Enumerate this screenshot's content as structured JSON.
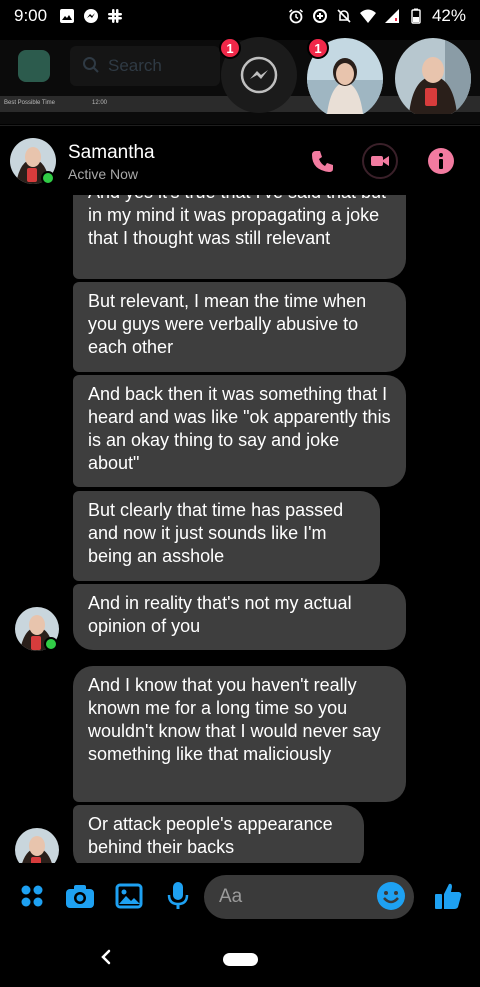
{
  "status_bar": {
    "time": "9:00",
    "battery": "42%"
  },
  "background_app": {
    "search_placeholder": "Search",
    "ticker_left": "Best Possible Time",
    "ticker_mid": "12:00"
  },
  "chat_heads": [
    {
      "id": "messenger",
      "badge": "1"
    },
    {
      "id": "samantha-a",
      "badge": "1"
    },
    {
      "id": "samantha-b",
      "badge": ""
    }
  ],
  "header": {
    "name": "Samantha",
    "status": "Active Now"
  },
  "messages": [
    {
      "text": "And yes it's true that I've said that but in my mind it was propagating a joke that I thought was still relevant"
    },
    {
      "text": "But relevant, I mean the time when you guys were verbally abusive to each other"
    },
    {
      "text": "And back then it was something that I heard and was like \"ok apparently this is an okay thing to say and joke about\""
    },
    {
      "text": "But clearly that time has passed and now it just sounds like I'm being an asshole"
    },
    {
      "text": "And in reality that's not my actual opinion of you"
    },
    {
      "text": "And I know that you haven't really known me for a long time so you wouldn't know that I would never say something like that maliciously"
    },
    {
      "text": "Or attack people's appearance behind their backs"
    }
  ],
  "composer": {
    "placeholder": "Aa"
  },
  "colors": {
    "accent_blue": "#1ea1f2",
    "accent_pink": "#f27ba0",
    "bubble": "#3e3e3e",
    "online": "#31cc46",
    "badge": "#f02849"
  }
}
